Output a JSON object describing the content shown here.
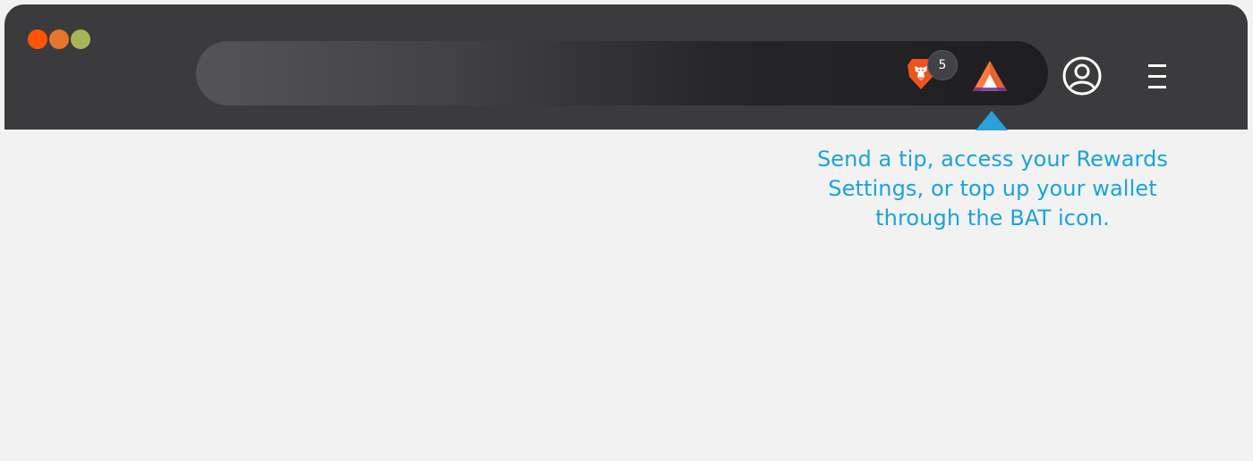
{
  "window": {
    "traffic_lights": [
      "close",
      "minimize",
      "zoom"
    ]
  },
  "toolbar": {
    "address_bar": {
      "value": ""
    },
    "brave_shields": {
      "icon": "brave-lion-icon",
      "badge_count": "5"
    },
    "bat_rewards": {
      "icon": "bat-triangle-icon"
    },
    "profile": {
      "icon": "profile-icon"
    },
    "menu": {
      "icon": "hamburger-menu-icon"
    }
  },
  "tooltip": {
    "lines": [
      "Send a tip, access your Rewards",
      "Settings, or top up your wallet",
      "through the BAT icon."
    ]
  },
  "colors": {
    "close": "#ff5400",
    "minimize": "#e6752f",
    "zoom": "#a6b559",
    "tooltip_text": "#1aa3dc",
    "pointer": "#2d9fd9",
    "toolbar_bg": "#3b3b3d",
    "page_bg": "#f2f2f2"
  }
}
